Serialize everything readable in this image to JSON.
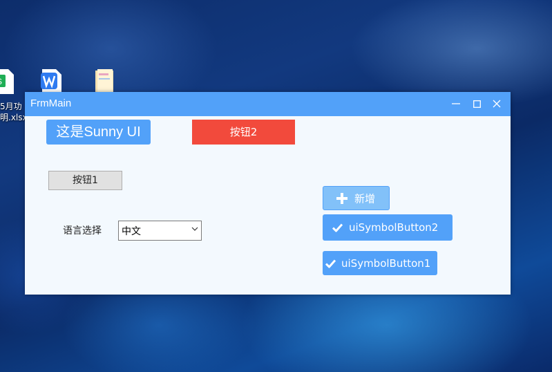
{
  "desktop": {
    "icons": [
      {
        "name": "excel-file-icon",
        "label": "5月功",
        "label2": "明.xlsx"
      },
      {
        "name": "wps-file-icon"
      },
      {
        "name": "folder-file-icon"
      }
    ]
  },
  "window": {
    "title": "FrmMain",
    "controls": {
      "minimize": "—",
      "maximize": "☐",
      "close": "✕"
    }
  },
  "form": {
    "sunny_label": "这是Sunny UI",
    "button2_label": "按钮2",
    "button1_label": "按钮1",
    "language_label": "语言选择",
    "language_value": "中文",
    "add_button_label": "新增",
    "symbol_button2_label": "uiSymbolButton2",
    "symbol_button1_label": "uiSymbolButton1"
  },
  "colors": {
    "primary": "#52a1f9",
    "danger": "#f24a3c",
    "window_bg": "#f3f9fe"
  }
}
